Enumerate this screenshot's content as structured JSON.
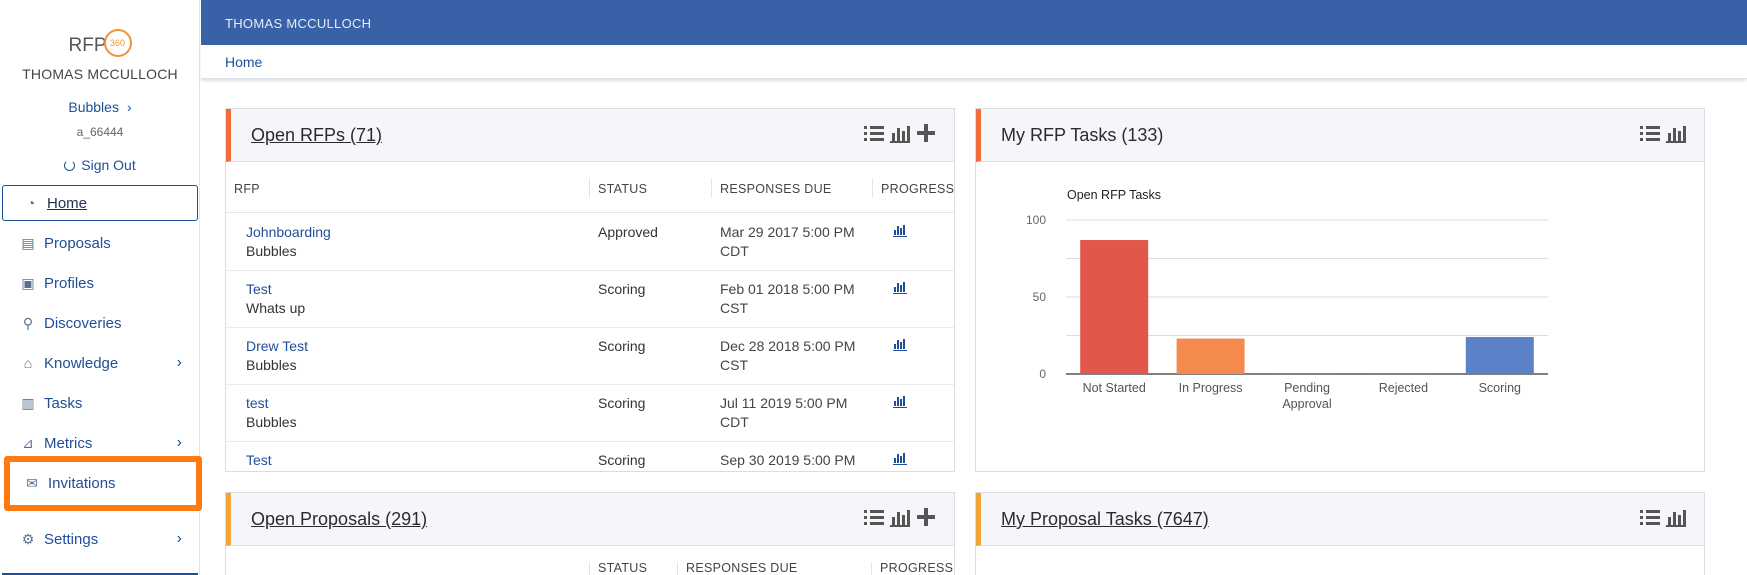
{
  "sidebar": {
    "logo_text": "RFP",
    "logo_badge": "360",
    "user_name": "THOMAS MCCULLOCH",
    "org_label": "Bubbles",
    "user_id": "a_66444",
    "sign_out": "Sign Out",
    "items": [
      {
        "label": "Home",
        "icon": "dashboard-icon"
      },
      {
        "label": "Proposals",
        "icon": "document-icon"
      },
      {
        "label": "Profiles",
        "icon": "profile-card-icon"
      },
      {
        "label": "Discoveries",
        "icon": "search-icon"
      },
      {
        "label": "Knowledge",
        "icon": "bank-icon"
      },
      {
        "label": "Tasks",
        "icon": "clipboard-icon"
      },
      {
        "label": "Metrics",
        "icon": "chart-icon"
      },
      {
        "label": "Invitations",
        "icon": "envelope-icon"
      },
      {
        "label": "Settings",
        "icon": "gear-icon"
      }
    ]
  },
  "header": {
    "user_name": "THOMAS MCCULLOCH",
    "breadcrumb": "Home"
  },
  "open_rfps": {
    "title": "Open RFPs (71)",
    "columns": [
      "RFP",
      "STATUS",
      "RESPONSES DUE",
      "PROGRESS"
    ],
    "rows": [
      {
        "name": "Johnboarding",
        "sub": "Bubbles",
        "status": "Approved",
        "due1": "Mar 29 2017 5:00 PM",
        "due2": "CDT"
      },
      {
        "name": "Test",
        "sub": "Whats up",
        "status": "Scoring",
        "due1": "Feb 01 2018 5:00 PM",
        "due2": "CST"
      },
      {
        "name": "Drew Test",
        "sub": "Bubbles",
        "status": "Scoring",
        "due1": "Dec 28 2018 5:00 PM",
        "due2": "CST"
      },
      {
        "name": "test",
        "sub": "Bubbles",
        "status": "Scoring",
        "due1": "Jul 11 2019 5:00 PM",
        "due2": "CDT"
      },
      {
        "name": "Test",
        "sub": "",
        "status": "Scoring",
        "due1": "Sep 30 2019 5:00 PM",
        "due2": ""
      }
    ]
  },
  "rfp_tasks": {
    "title": "My RFP Tasks (133)"
  },
  "open_proposals": {
    "title": "Open Proposals (291)",
    "columns": [
      "STATUS",
      "RESPONSES DUE",
      "PROGRESS"
    ]
  },
  "proposal_tasks": {
    "title": "My Proposal Tasks (7647)"
  },
  "chart_data": {
    "type": "bar",
    "title": "Open RFP Tasks",
    "categories": [
      "Not Started",
      "In Progress",
      "Pending Approval",
      "Rejected",
      "Scoring"
    ],
    "category_lines": [
      [
        "Not Started"
      ],
      [
        "In Progress"
      ],
      [
        "Pending",
        "Approval"
      ],
      [
        "Rejected"
      ],
      [
        "Scoring"
      ]
    ],
    "values": [
      87,
      23,
      0,
      0,
      24
    ],
    "colors": [
      "#e2574c",
      "#f58a4f",
      "#888888",
      "#888888",
      "#5b82c8"
    ],
    "ylim": [
      0,
      100
    ],
    "yticks": [
      0,
      50,
      100
    ],
    "grid": true
  }
}
